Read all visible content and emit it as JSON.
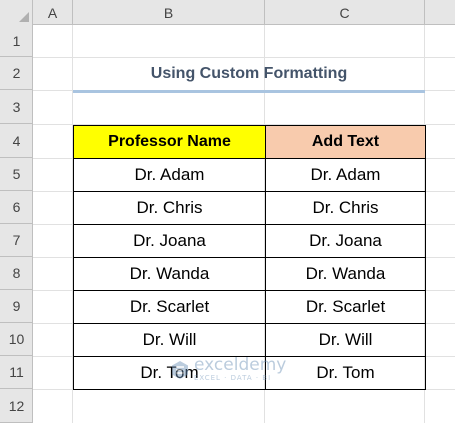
{
  "columns": [
    "A",
    "B",
    "C"
  ],
  "rows": [
    "1",
    "2",
    "3",
    "4",
    "5",
    "6",
    "7",
    "8",
    "9",
    "10",
    "11",
    "12"
  ],
  "title": "Using Custom Formatting",
  "table": {
    "headers": [
      "Professor Name",
      "Add Text"
    ],
    "col_b": [
      "Dr. Adam",
      "Dr. Chris",
      "Dr. Joana",
      "Dr. Wanda",
      "Dr. Scarlet",
      "Dr. Will",
      "Dr. Tom"
    ],
    "col_c": [
      "Dr. Adam",
      "Dr. Chris",
      "Dr. Joana",
      "Dr. Wanda",
      "Dr. Scarlet",
      "Dr. Will",
      "Dr. Tom"
    ]
  },
  "watermark": {
    "name": "exceldemy",
    "tagline": "EXCEL · DATA · BI",
    "icon": "exceldemy-logo-icon"
  },
  "colors": {
    "header_b_fill": "#ffff00",
    "header_c_fill": "#f8cbad",
    "title_color": "#44546a",
    "title_underline": "#a9c4e0"
  }
}
